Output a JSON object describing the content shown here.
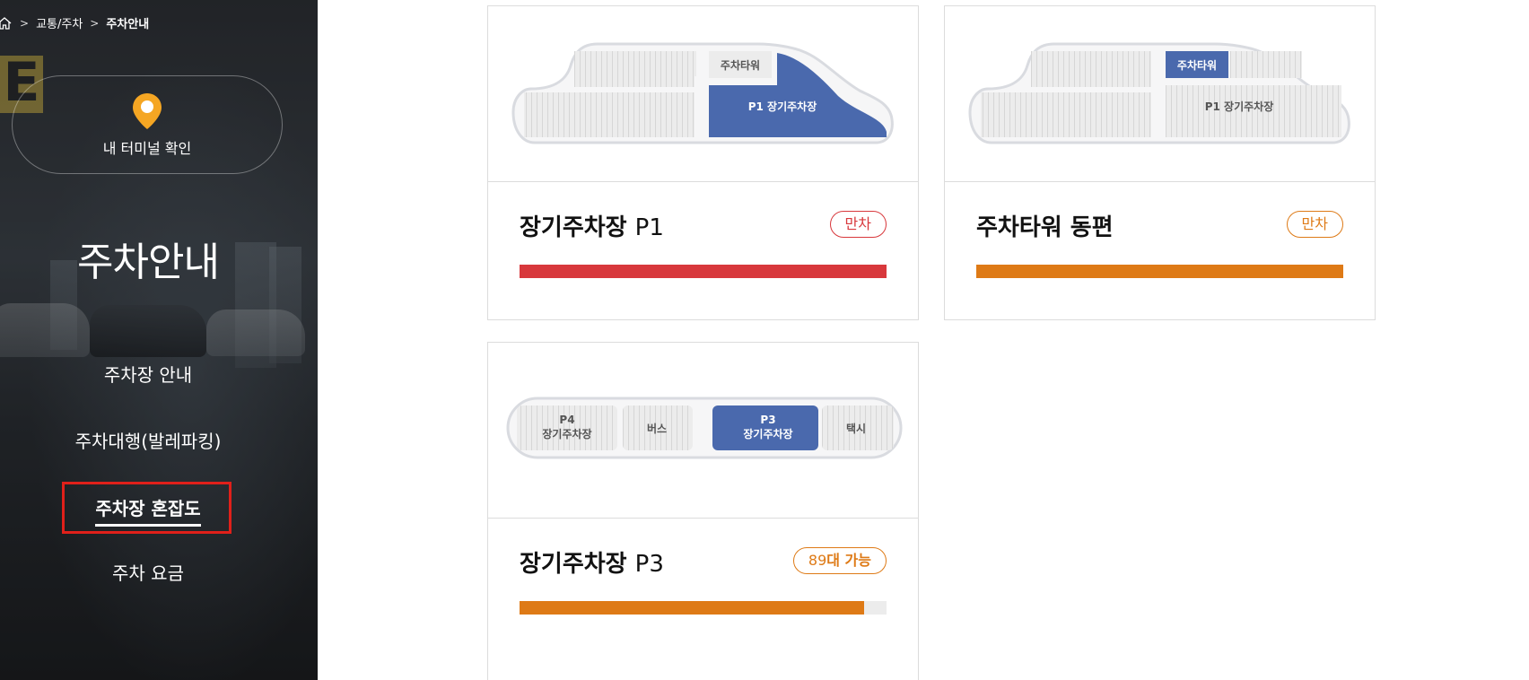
{
  "breadcrumb": {
    "items": [
      "교통/주차"
    ],
    "current": "주차안내"
  },
  "sidebar": {
    "terminal_button": "내 터미널 확인",
    "heading": "주차안내",
    "nav": [
      {
        "label": "주차장 안내"
      },
      {
        "label": "주차대행(발레파킹)"
      },
      {
        "label": "주차장 혼잡도"
      },
      {
        "label": "주차 요금"
      }
    ],
    "active_index": 2
  },
  "colors": {
    "accent_blue": "#4a69ad",
    "status_red": "#d8383c",
    "status_orange": "#de7a16",
    "highlight_box": "#e0201a"
  },
  "cards": [
    {
      "title": "장기주차장",
      "code": "P1",
      "badge": "만차",
      "badge_color": "red",
      "fill_percent": 100,
      "map": {
        "tower_label": "주차타워",
        "lot_label": "P1 장기주차장",
        "highlight": "lot"
      }
    },
    {
      "title": "주차타워 동편",
      "code": "",
      "badge": "만차",
      "badge_color": "orange",
      "fill_percent": 100,
      "map": {
        "tower_label": "주차타워",
        "lot_label": "P1 장기주차장",
        "highlight": "tower"
      }
    },
    {
      "title": "장기주차장",
      "code": "P3",
      "badge_count": "89",
      "badge_suffix": "대 가능",
      "badge_color": "orange",
      "fill_percent": 94,
      "map": {
        "p4_line1": "P4",
        "p4_line2": "장기주차장",
        "bus": "버스",
        "p3_line1": "P3",
        "p3_line2": "장기주차장",
        "taxi": "택시"
      }
    }
  ]
}
